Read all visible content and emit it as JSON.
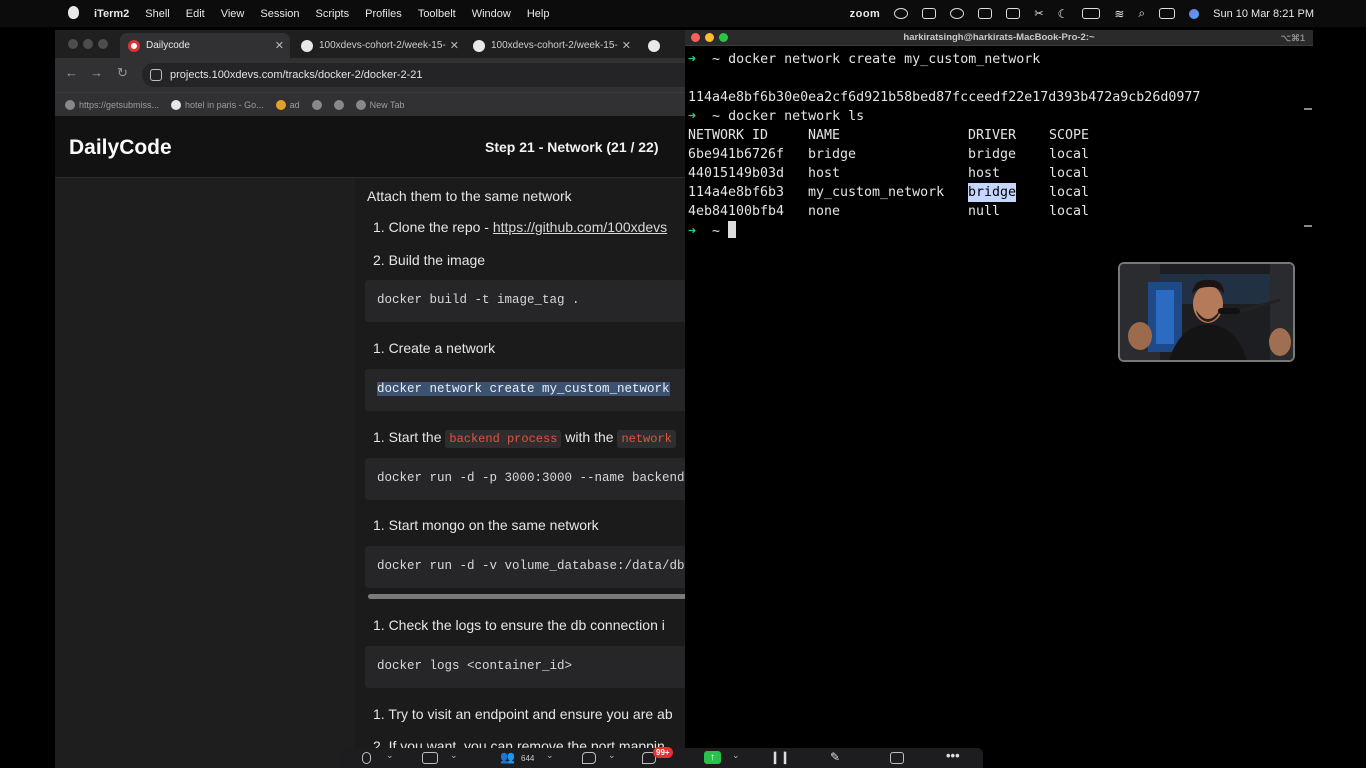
{
  "menubar": {
    "app_name": "iTerm2",
    "items": [
      "Shell",
      "Edit",
      "View",
      "Session",
      "Scripts",
      "Profiles",
      "Toolbelt",
      "Window",
      "Help"
    ],
    "zoom_label": "zoom",
    "clock": "Sun 10 Mar  8:21 PM"
  },
  "browser": {
    "tabs": [
      {
        "title": "Dailycode",
        "active": true
      },
      {
        "title": "100xdevs-cohort-2/week-15-",
        "active": false
      },
      {
        "title": "100xdevs-cohort-2/week-15-",
        "active": false
      }
    ],
    "url": "projects.100xdevs.com/tracks/docker-2/docker-2-21",
    "bookmarks": [
      "https://getsubmiss...",
      "hotel in paris - Go...",
      "ad",
      "New Tab"
    ]
  },
  "page": {
    "brand": "DailyCode",
    "step_title": "Step 21 - Network (21 / 22)",
    "intro": "Attach them to the same network",
    "step_clone": "1. Clone the repo - ",
    "clone_link": "https://github.com/100xdevs",
    "step_build": "2. Build the image",
    "code_build": "docker build -t image_tag .",
    "step_create": "1. Create a network",
    "code_create": "docker network create my_custom_network",
    "step_start_a": "1. Start the ",
    "step_start_code": "backend process",
    "step_start_b": " with the ",
    "step_start_code2": "network",
    "code_run_backend": "docker run -d -p 3000:3000 --name backend",
    "step_mongo": "1. Start mongo on the same network",
    "code_run_mongo": "docker run -d -v volume_database:/data/db",
    "step_logs": "1. Check the logs to ensure the db connection i",
    "code_logs": "docker logs <container_id>",
    "step_visit": "1. Try to visit an endpoint and ensure you are ab",
    "step_remove": "2. If you want, you can remove the port mappin"
  },
  "terminal": {
    "title": "harkiratsingh@harkirats-MacBook-Pro-2:~",
    "shortcut": "⌥⌘1",
    "prompt_char": "➜",
    "prompt_dir": "~",
    "cmd1": "docker network create my_custom_network",
    "network_hash": "114a4e8bf6b30e0ea2cf6d921b58bed87fcceedf22e17d393b472a9cb26d0977",
    "cmd2": "docker network ls",
    "table_header": [
      "NETWORK ID",
      "NAME",
      "DRIVER",
      "SCOPE"
    ],
    "rows": [
      [
        "6be941b6726f",
        "bridge",
        "bridge",
        "local"
      ],
      [
        "44015149b03d",
        "host",
        "host",
        "local"
      ],
      [
        "114a4e8bf6b3",
        "my_custom_network",
        "bridge",
        "local"
      ],
      [
        "4eb84100bfb4",
        "none",
        "null",
        "local"
      ]
    ]
  },
  "zoombar": {
    "participants": "644",
    "chat_badge": "99+"
  }
}
